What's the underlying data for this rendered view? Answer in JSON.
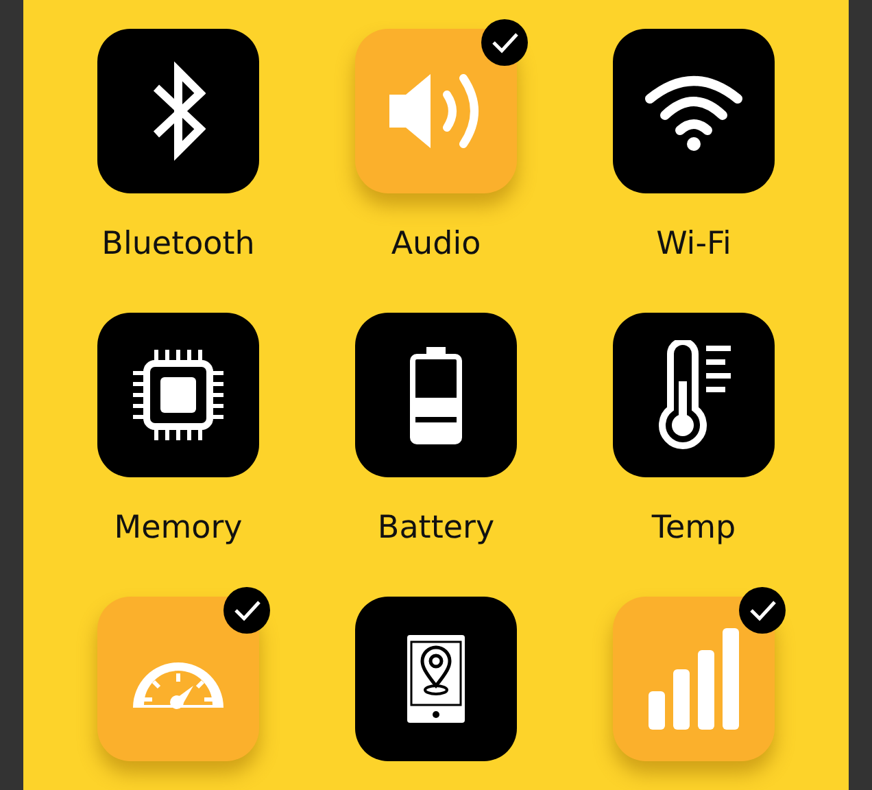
{
  "tiles": [
    {
      "label": "Bluetooth",
      "selected": false
    },
    {
      "label": "Audio",
      "selected": true
    },
    {
      "label": "Wi-Fi",
      "selected": false
    },
    {
      "label": "Memory",
      "selected": false
    },
    {
      "label": "Battery",
      "selected": false
    },
    {
      "label": "Temp",
      "selected": false
    },
    {
      "selected": true
    },
    {
      "selected": false
    },
    {
      "selected": true
    }
  ]
}
